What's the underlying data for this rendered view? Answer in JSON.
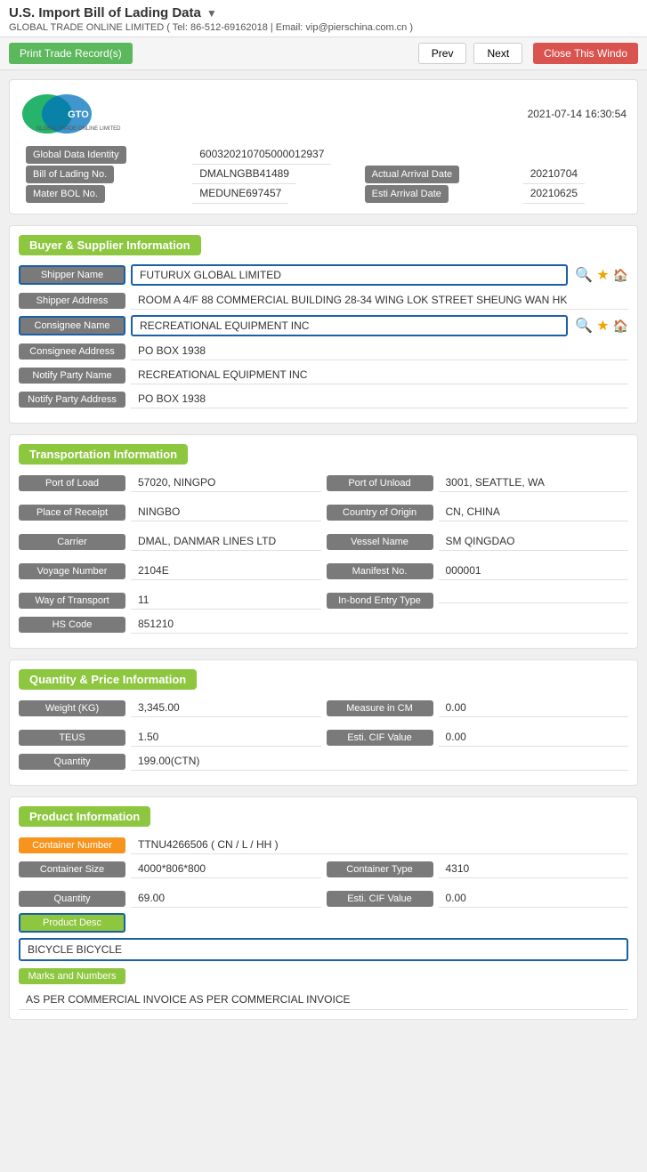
{
  "page": {
    "title": "U.S. Import Bill of Lading Data",
    "subtitle": "GLOBAL TRADE ONLINE LIMITED ( Tel: 86-512-69162018 | Email: vip@pierschina.com.cn )",
    "timestamp": "2021-07-14 16:30:54"
  },
  "toolbar": {
    "print_label": "Print Trade Record(s)",
    "prev_label": "Prev",
    "next_label": "Next",
    "close_label": "Close This Windo"
  },
  "header_fields": {
    "global_data_identity_label": "Global Data Identity",
    "global_data_identity_value": "600320210705000012937",
    "bill_of_lading_label": "Bill of Lading No.",
    "bill_of_lading_value": "DMALNGBB41489",
    "actual_arrival_date_label": "Actual Arrival Date",
    "actual_arrival_date_value": "20210704",
    "master_bol_label": "Mater BOL No.",
    "master_bol_value": "MEDUNE697457",
    "esti_arrival_date_label": "Esti Arrival Date",
    "esti_arrival_date_value": "20210625"
  },
  "buyer_supplier": {
    "section_title": "Buyer & Supplier Information",
    "shipper_name_label": "Shipper Name",
    "shipper_name_value": "FUTURUX GLOBAL LIMITED",
    "shipper_address_label": "Shipper Address",
    "shipper_address_value": "ROOM A 4/F 88 COMMERCIAL BUILDING 28-34 WING LOK STREET SHEUNG WAN HK",
    "consignee_name_label": "Consignee Name",
    "consignee_name_value": "RECREATIONAL EQUIPMENT INC",
    "consignee_address_label": "Consignee Address",
    "consignee_address_value": "PO BOX 1938",
    "notify_party_name_label": "Notify Party Name",
    "notify_party_name_value": "RECREATIONAL EQUIPMENT INC",
    "notify_party_address_label": "Notify Party Address",
    "notify_party_address_value": "PO BOX 1938"
  },
  "transportation": {
    "section_title": "Transportation Information",
    "port_of_load_label": "Port of Load",
    "port_of_load_value": "57020, NINGPO",
    "port_of_unload_label": "Port of Unload",
    "port_of_unload_value": "3001, SEATTLE, WA",
    "place_of_receipt_label": "Place of Receipt",
    "place_of_receipt_value": "NINGBO",
    "country_of_origin_label": "Country of Origin",
    "country_of_origin_value": "CN, CHINA",
    "carrier_label": "Carrier",
    "carrier_value": "DMAL, DANMAR LINES LTD",
    "vessel_name_label": "Vessel Name",
    "vessel_name_value": "SM QINGDAO",
    "voyage_number_label": "Voyage Number",
    "voyage_number_value": "2104E",
    "manifest_no_label": "Manifest No.",
    "manifest_no_value": "000001",
    "way_of_transport_label": "Way of Transport",
    "way_of_transport_value": "11",
    "inbond_entry_type_label": "In-bond Entry Type",
    "inbond_entry_type_value": "",
    "hs_code_label": "HS Code",
    "hs_code_value": "851210"
  },
  "quantity_price": {
    "section_title": "Quantity & Price Information",
    "weight_label": "Weight (KG)",
    "weight_value": "3,345.00",
    "measure_label": "Measure in CM",
    "measure_value": "0.00",
    "teus_label": "TEUS",
    "teus_value": "1.50",
    "esti_cif_label": "Esti. CIF Value",
    "esti_cif_value": "0.00",
    "quantity_label": "Quantity",
    "quantity_value": "199.00(CTN)"
  },
  "product": {
    "section_title": "Product Information",
    "container_number_label": "Container Number",
    "container_number_value": "TTNU4266506 ( CN / L / HH )",
    "container_size_label": "Container Size",
    "container_size_value": "4000*806*800",
    "container_type_label": "Container Type",
    "container_type_value": "4310",
    "quantity_label": "Quantity",
    "quantity_value": "69.00",
    "esti_cif_label": "Esti. CIF Value",
    "esti_cif_value": "0.00",
    "product_desc_label": "Product Desc",
    "product_desc_value": "BICYCLE BICYCLE",
    "marks_and_numbers_label": "Marks and Numbers",
    "marks_and_numbers_value": "AS PER COMMERCIAL INVOICE AS PER COMMERCIAL INVOICE"
  }
}
